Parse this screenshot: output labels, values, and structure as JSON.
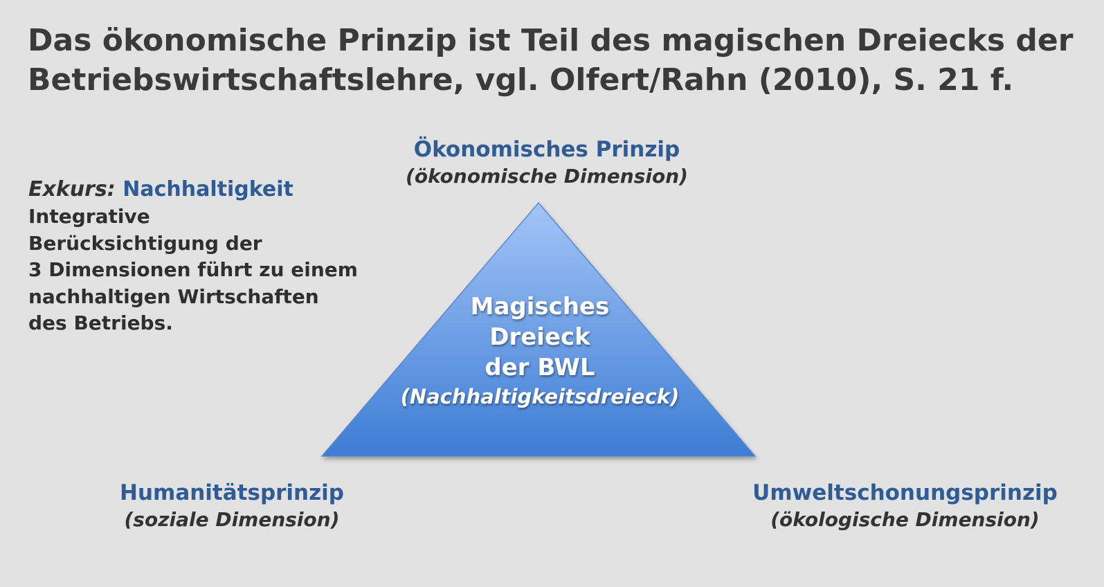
{
  "title": {
    "line1": "Das ökonomische Prinzip ist Teil des magischen Dreiecks der",
    "line2": "Betriebswirtschaftslehre, vgl. Olfert/Rahn (2010), S. 21 f."
  },
  "exkurs": {
    "label": "Exkurs:",
    "topic": "Nachhaltigkeit",
    "lines": [
      "Integrative",
      "Berücksichtigung der",
      "3 Dimensionen führt zu einem",
      "nachhaltigen Wirtschaften",
      "des Betriebs."
    ]
  },
  "triangle": {
    "lines": [
      "Magisches",
      "Dreieck",
      "der BWL"
    ],
    "subtitle": "(Nachhaltigkeitsdreieck)",
    "colors": {
      "top": "#a3c4f7",
      "bottom": "#3d7dd4",
      "stroke": "#5d88c8"
    }
  },
  "principles": {
    "top": {
      "name": "Ökonomisches Prinzip",
      "dimension": "(ökonomische Dimension)"
    },
    "left": {
      "name": "Humanitätsprinzip",
      "dimension": "(soziale Dimension)"
    },
    "right": {
      "name": "Umweltschonungsprinzip",
      "dimension": "(ökologische Dimension)"
    }
  },
  "colors": {
    "background": "#e2e2e2",
    "heading_blue": "#2f5c95",
    "text_dark": "#333333"
  }
}
